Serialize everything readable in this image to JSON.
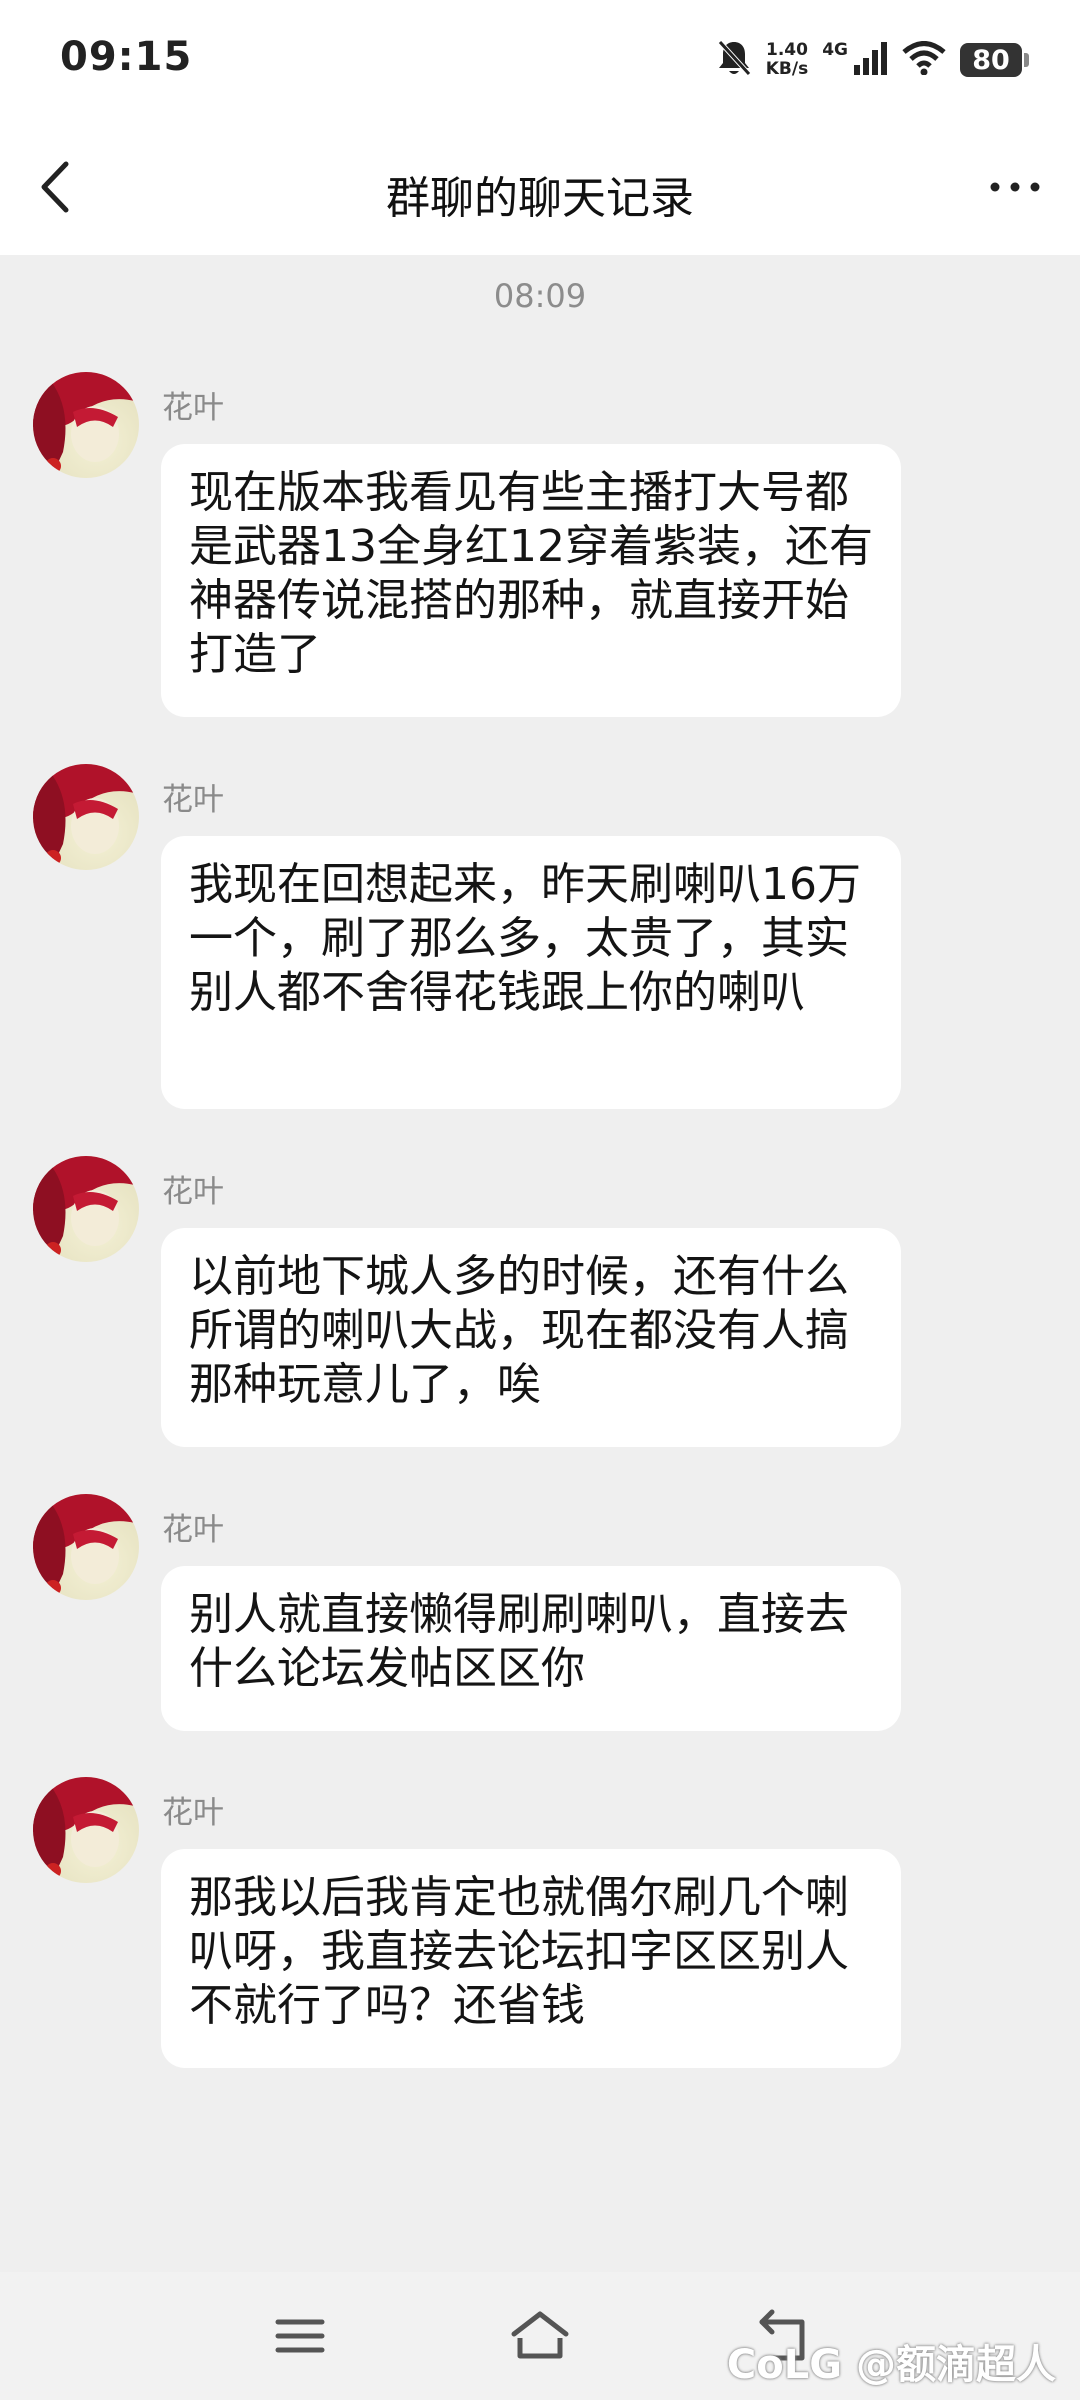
{
  "status_bar": {
    "time": "09:15",
    "net_speed_value": "1.40",
    "net_speed_unit": "KB/s",
    "network": "4G",
    "battery": "80"
  },
  "header": {
    "title": "群聊的聊天记录",
    "back_icon": "chevron-left-icon",
    "more_icon": "more-horizontal-icon"
  },
  "timestamp": "08:09",
  "messages": [
    {
      "sender": "花叶",
      "text": "现在版本我看见有些主播打大号都是武器13全身红12穿着紫装，还有神器传说混搭的那种，就直接开始打造了"
    },
    {
      "sender": "花叶",
      "text": "我现在回想起来，昨天刷喇叭16万一个，刷了那么多，太贵了，其实别人都不舍得花钱跟上你的喇叭"
    },
    {
      "sender": "花叶",
      "text": "以前地下城人多的时候，还有什么所谓的喇叭大战，现在都没有人搞那种玩意儿了，唉"
    },
    {
      "sender": "花叶",
      "text": "别人就直接懒得刷刷喇叭，直接去什么论坛发帖区区你"
    },
    {
      "sender": "花叶",
      "text": "那我以后我肯定也就偶尔刷几个喇叭呀，我直接去论坛扣字区区别人不就行了吗？还省钱"
    }
  ],
  "nav_bar": {
    "icons": [
      "menu-icon",
      "home-icon",
      "back-return-icon"
    ]
  },
  "watermark": "CoLG @额滴超人",
  "colors": {
    "background": "#efefef",
    "bubble": "#ffffff",
    "sender": "#8a8a8a",
    "timestamp": "#8c8c8c"
  }
}
